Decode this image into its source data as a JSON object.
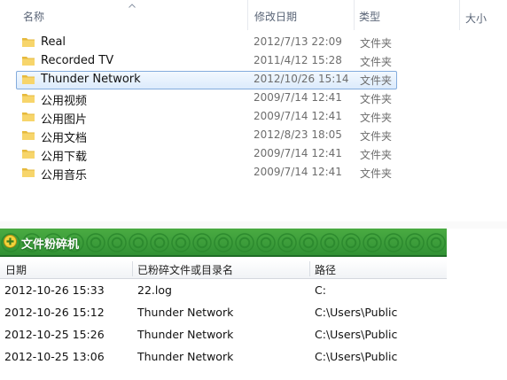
{
  "explorer": {
    "columns": {
      "name": "名称",
      "modified": "修改日期",
      "type": "类型",
      "size": "大小"
    },
    "items": [
      {
        "name": "Real",
        "modified": "2012/7/13 22:09",
        "type": "文件夹",
        "selected": false
      },
      {
        "name": "Recorded TV",
        "modified": "2011/4/12 15:28",
        "type": "文件夹",
        "selected": false
      },
      {
        "name": "Thunder Network",
        "modified": "2012/10/26 15:14",
        "type": "文件夹",
        "selected": true
      },
      {
        "name": "公用视频",
        "modified": "2009/7/14 12:41",
        "type": "文件夹",
        "selected": false
      },
      {
        "name": "公用图片",
        "modified": "2009/7/14 12:41",
        "type": "文件夹",
        "selected": false
      },
      {
        "name": "公用文档",
        "modified": "2012/8/23 18:05",
        "type": "文件夹",
        "selected": false
      },
      {
        "name": "公用下载",
        "modified": "2009/7/14 12:41",
        "type": "文件夹",
        "selected": false
      },
      {
        "name": "公用音乐",
        "modified": "2009/7/14 12:41",
        "type": "文件夹",
        "selected": false
      }
    ],
    "icons": {
      "sort": "sort-ascending-arrow-icon",
      "folder": "folder-icon"
    },
    "colors": {
      "selection_border": "#84acdd",
      "selection_fill": "#dcebfc",
      "folder": "#f2c84b"
    }
  },
  "shredder": {
    "title": "文件粉碎机",
    "icon": "add-circle-icon",
    "header_color": "#3a9b3a",
    "columns": {
      "date": "日期",
      "name": "已粉碎文件或目录名",
      "path": "路径"
    },
    "rows": [
      {
        "date": "2012-10-26 15:33",
        "name": "22.log",
        "path": "C:"
      },
      {
        "date": "2012-10-26 15:12",
        "name": "Thunder Network",
        "path": "C:\\Users\\Public"
      },
      {
        "date": "2012-10-25 15:26",
        "name": "Thunder Network",
        "path": "C:\\Users\\Public"
      },
      {
        "date": "2012-10-25 13:06",
        "name": "Thunder Network",
        "path": "C:\\Users\\Public"
      }
    ]
  }
}
